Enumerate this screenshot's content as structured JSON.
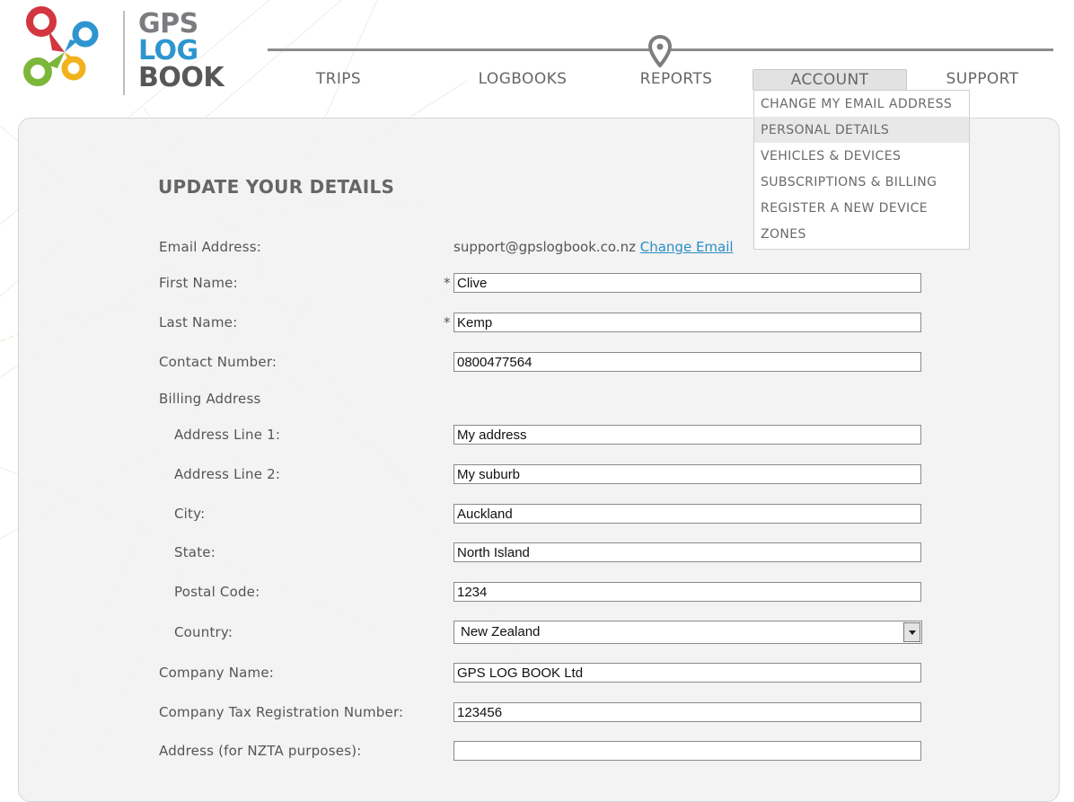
{
  "brand": {
    "line1": "GPS",
    "line2": "LOG",
    "line3": "BOOK"
  },
  "nav": {
    "items": [
      "TRIPS",
      "LOGBOOKS",
      "REPORTS",
      "ACCOUNT",
      "SUPPORT"
    ],
    "active": "ACCOUNT",
    "pin_icon": "map-pin-icon"
  },
  "account_menu": {
    "items": [
      "CHANGE MY EMAIL ADDRESS",
      "PERSONAL DETAILS",
      "VEHICLES & DEVICES",
      "SUBSCRIPTIONS & BILLING",
      "REGISTER A NEW DEVICE",
      "ZONES"
    ],
    "highlighted": "PERSONAL DETAILS"
  },
  "page": {
    "title": "UPDATE YOUR DETAILS"
  },
  "form": {
    "email_label": "Email Address:",
    "email_value": "support@gpslogbook.co.nz",
    "change_email_link": "Change Email",
    "required_mark": "*",
    "first_name_label": "First Name:",
    "first_name": "Clive",
    "last_name_label": "Last Name:",
    "last_name": "Kemp",
    "contact_label": "Contact Number:",
    "contact": "0800477564",
    "billing_heading": "Billing Address",
    "address1_label": "Address Line 1:",
    "address1": "My address",
    "address2_label": "Address Line 2:",
    "address2": "My suburb",
    "city_label": "City:",
    "city": "Auckland",
    "state_label": "State:",
    "state": "North Island",
    "postal_label": "Postal Code:",
    "postal": "1234",
    "country_label": "Country:",
    "country": "New Zealand",
    "company_label": "Company Name:",
    "company": "GPS LOG BOOK Ltd",
    "tax_label": "Company Tax Registration Number:",
    "tax": "123456",
    "nzta_label": "Address (for NZTA purposes):",
    "nzta": ""
  },
  "colors": {
    "brand_blue": "#2e95d0",
    "link": "#2a8ec4",
    "logo_red": "#d3363f",
    "logo_blue": "#2e95d0",
    "logo_green": "#7cb63a",
    "logo_yellow": "#f2b21c"
  }
}
